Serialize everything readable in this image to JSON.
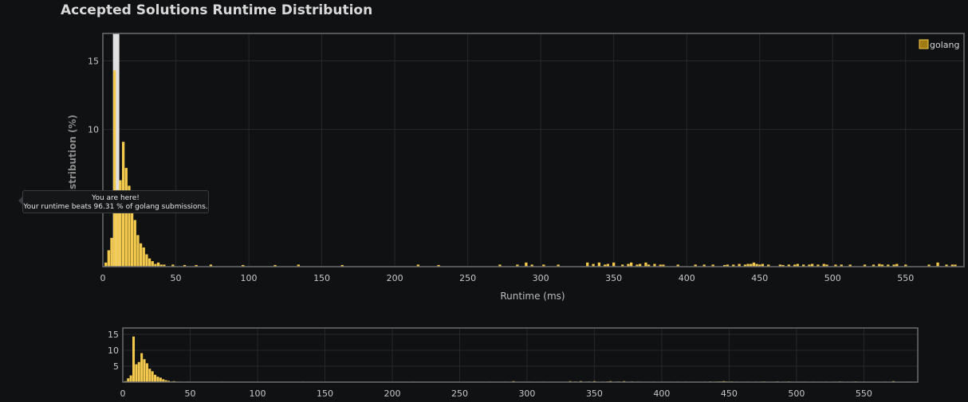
{
  "chart_data": [
    {
      "type": "bar",
      "title": "Accepted Solutions Runtime Distribution",
      "xlabel": "Runtime (ms)",
      "ylabel": "Distribution (%)",
      "xlim": [
        0,
        590
      ],
      "ylim": [
        0,
        17
      ],
      "xticks": [
        0,
        50,
        100,
        150,
        200,
        250,
        300,
        350,
        400,
        450,
        500,
        550
      ],
      "yticks": [
        15,
        10
      ],
      "grid": true,
      "legend_position": "top-right",
      "series": [
        {
          "name": "golang",
          "color": "#f2c94c",
          "points": [
            [
              2,
              0.3
            ],
            [
              4,
              1.2
            ],
            [
              6,
              2.1
            ],
            [
              8,
              14.3
            ],
            [
              10,
              5.6
            ],
            [
              12,
              6.3
            ],
            [
              14,
              9.1
            ],
            [
              16,
              7.2
            ],
            [
              18,
              5.9
            ],
            [
              20,
              4.2
            ],
            [
              22,
              3.4
            ],
            [
              24,
              2.3
            ],
            [
              26,
              1.7
            ],
            [
              28,
              1.4
            ],
            [
              30,
              0.9
            ],
            [
              32,
              0.6
            ],
            [
              34,
              0.4
            ],
            [
              36,
              0.2
            ],
            [
              38,
              0.3
            ],
            [
              40,
              0.15
            ],
            [
              42,
              0.15
            ],
            [
              48,
              0.15
            ],
            [
              56,
              0.12
            ],
            [
              64,
              0.12
            ],
            [
              74,
              0.15
            ],
            [
              96,
              0.12
            ],
            [
              118,
              0.12
            ],
            [
              134,
              0.15
            ],
            [
              164,
              0.12
            ],
            [
              216,
              0.15
            ],
            [
              230,
              0.12
            ],
            [
              272,
              0.15
            ],
            [
              284,
              0.15
            ],
            [
              290,
              0.3
            ],
            [
              294,
              0.15
            ],
            [
              302,
              0.15
            ],
            [
              312,
              0.15
            ],
            [
              332,
              0.3
            ],
            [
              336,
              0.2
            ],
            [
              340,
              0.3
            ],
            [
              344,
              0.15
            ],
            [
              346,
              0.2
            ],
            [
              350,
              0.3
            ],
            [
              356,
              0.15
            ],
            [
              360,
              0.2
            ],
            [
              362,
              0.3
            ],
            [
              366,
              0.15
            ],
            [
              368,
              0.2
            ],
            [
              372,
              0.3
            ],
            [
              374,
              0.15
            ],
            [
              378,
              0.2
            ],
            [
              382,
              0.15
            ],
            [
              384,
              0.15
            ],
            [
              394,
              0.15
            ],
            [
              406,
              0.15
            ],
            [
              412,
              0.15
            ],
            [
              418,
              0.15
            ],
            [
              426,
              0.12
            ],
            [
              428,
              0.15
            ],
            [
              432,
              0.15
            ],
            [
              436,
              0.2
            ],
            [
              440,
              0.15
            ],
            [
              442,
              0.2
            ],
            [
              444,
              0.2
            ],
            [
              446,
              0.3
            ],
            [
              448,
              0.2
            ],
            [
              450,
              0.15
            ],
            [
              452,
              0.2
            ],
            [
              456,
              0.15
            ],
            [
              464,
              0.15
            ],
            [
              466,
              0.12
            ],
            [
              470,
              0.15
            ],
            [
              474,
              0.15
            ],
            [
              476,
              0.2
            ],
            [
              480,
              0.15
            ],
            [
              484,
              0.15
            ],
            [
              486,
              0.2
            ],
            [
              490,
              0.15
            ],
            [
              494,
              0.2
            ],
            [
              496,
              0.15
            ],
            [
              502,
              0.15
            ],
            [
              506,
              0.15
            ],
            [
              512,
              0.15
            ],
            [
              522,
              0.15
            ],
            [
              528,
              0.15
            ],
            [
              532,
              0.2
            ],
            [
              534,
              0.15
            ],
            [
              538,
              0.15
            ],
            [
              542,
              0.15
            ],
            [
              544,
              0.2
            ],
            [
              550,
              0.15
            ],
            [
              566,
              0.15
            ],
            [
              572,
              0.3
            ],
            [
              578,
              0.15
            ],
            [
              582,
              0.15
            ],
            [
              584,
              0.15
            ]
          ]
        }
      ],
      "highlight": {
        "x": 8
      },
      "tooltip": {
        "title": "You are here!",
        "text": "Your runtime beats 96.31 % of golang submissions."
      }
    },
    {
      "type": "bar",
      "xlim": [
        0,
        590
      ],
      "ylim": [
        0,
        17
      ],
      "xticks": [
        0,
        50,
        100,
        150,
        200,
        250,
        300,
        350,
        400,
        450,
        500,
        550
      ],
      "yticks": [
        15,
        10,
        5
      ],
      "grid": true
    }
  ]
}
